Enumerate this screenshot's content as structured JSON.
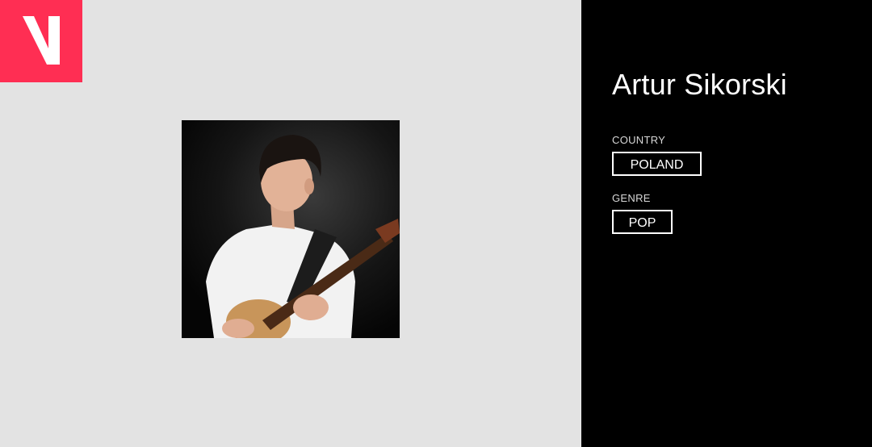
{
  "brand": {
    "logo_icon": "v-logo-icon",
    "accent_color": "#ff2e53"
  },
  "artist": {
    "name": "Artur Sikorski",
    "photo_icon": "artist-photo-guitar"
  },
  "details": {
    "country_label": "COUNTRY",
    "country_value": "POLAND",
    "genre_label": "GENRE",
    "genre_value": "POP"
  },
  "colors": {
    "left_background": "#e3e3e3",
    "right_background": "#000000"
  }
}
